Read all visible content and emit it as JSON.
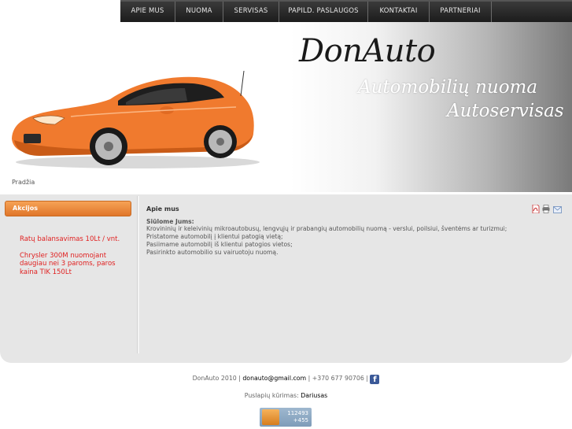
{
  "nav": {
    "items": [
      {
        "label": "APIE MUS"
      },
      {
        "label": "NUOMA"
      },
      {
        "label": "SERVISAS"
      },
      {
        "label": "PAPILD. PASLAUGOS"
      },
      {
        "label": "KONTAKTAI"
      },
      {
        "label": "PARTNERIAI"
      }
    ]
  },
  "header": {
    "logo": "DonAuto",
    "tagline1": "Automobilių nuoma",
    "tagline2": "Autoservisas",
    "breadcrumb": "Pradžia"
  },
  "sidebar": {
    "title": "Akcijos",
    "promos": [
      "Ratų balansavimas 10Lt / vnt.",
      "Chrysler 300M nuomojant daugiau nei 3 paroms, paros kaina TIK 150Lt"
    ]
  },
  "main": {
    "title": "Apie mus",
    "intro": "Siūlome Jums:",
    "lines": [
      "Krovininių ir keleivinių mikroautobusų, lengvųjų ir prabangių automobilių nuomą - verslui, poilsiui, šventėms ar turizmui;",
      "Pristatome automobilį į klientui patogią vietą;",
      "Pasiimame automobilį iš klientui patogios vietos;",
      "Pasirinkto automobilio su vairuotoju nuomą."
    ],
    "tool_icons": [
      "pdf-icon",
      "print-icon",
      "email-icon"
    ]
  },
  "footer": {
    "copyright": "DonAuto 2010 |",
    "email": "donauto@gmail.com",
    "phone": "| +370 677 90706 |",
    "credit_label": "Puslapių kūrimas:",
    "credit_name": "Dariusas",
    "counter_total": "112493",
    "counter_today": "+455"
  },
  "colors": {
    "accent": "#e8832f",
    "promo_text": "#e01f1f",
    "nav_bg": "#2b2b2b"
  }
}
